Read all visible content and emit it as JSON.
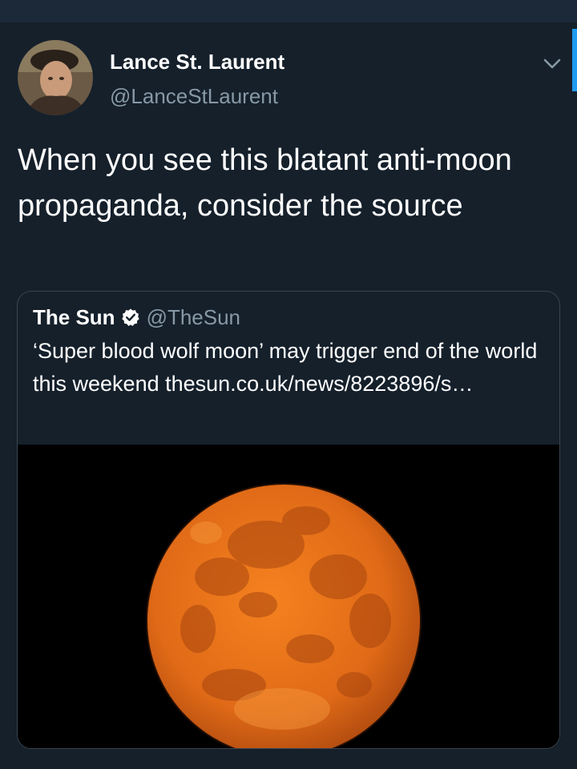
{
  "tweet": {
    "author": {
      "name": "Lance St. Laurent",
      "handle": "@LanceStLaurent"
    },
    "text": "When you see this blatant anti-moon propaganda, consider the source"
  },
  "quoted_tweet": {
    "author": {
      "name": "The Sun",
      "handle": "@TheSun",
      "verified": true
    },
    "text": "‘Super blood wolf moon’ may trigger end of the world this weekend thesun.co.uk/news/8223896/s…",
    "media": {
      "subject": "orange full moon on black sky"
    }
  },
  "icons": {
    "caret": "chevron-down-icon",
    "verified": "verified-badge-icon"
  },
  "colors": {
    "background": "#15202b",
    "secondary_text": "#8899a6",
    "border": "#38444d",
    "accent": "#1d9bf0",
    "moon": "#e8711e"
  }
}
